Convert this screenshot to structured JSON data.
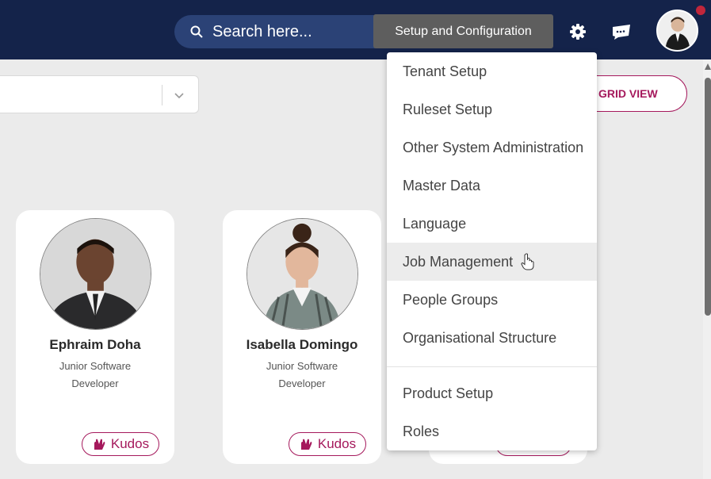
{
  "header": {
    "search_placeholder": "Search here...",
    "tooltip": "Setup and Configuration",
    "icons": [
      "search-icon",
      "gear-icon",
      "chat-icon",
      "user-avatar"
    ],
    "colors": {
      "topbar": "#14234a",
      "search": "#2b4276",
      "accent": "#a5195c"
    }
  },
  "toolbar": {
    "view_button_label": "GRID VIEW"
  },
  "menu": {
    "items": [
      {
        "label": "Tenant Setup"
      },
      {
        "label": "Ruleset Setup"
      },
      {
        "label": "Other System Administration"
      },
      {
        "label": "Master Data"
      },
      {
        "label": "Language"
      },
      {
        "label": "Job Management"
      },
      {
        "label": "People Groups"
      },
      {
        "label": "Organisational Structure"
      },
      {
        "label": "Product Setup"
      },
      {
        "label": "Roles"
      }
    ],
    "hovered_item": "Job Management"
  },
  "cards": [
    {
      "name": "Ephraim Doha",
      "role": "Junior Software Developer",
      "kudos_label": "Kudos"
    },
    {
      "name": "Isabella Domingo",
      "role": "Junior Software Developer",
      "kudos_label": "Kudos"
    }
  ]
}
